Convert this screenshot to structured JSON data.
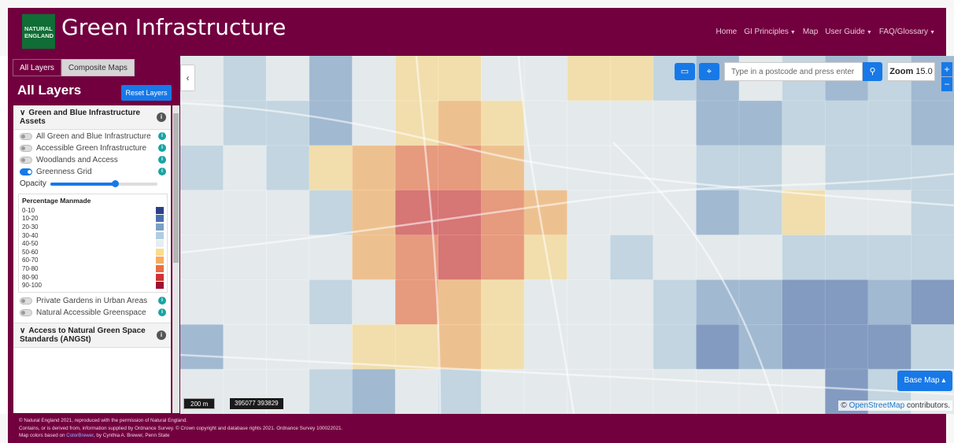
{
  "header": {
    "logo_line1": "NATURAL",
    "logo_line2": "ENGLAND",
    "title": "Green Infrastructure",
    "nav": [
      {
        "label": "Home",
        "dropdown": false
      },
      {
        "label": "GI Principles",
        "dropdown": true
      },
      {
        "label": "Map",
        "dropdown": false
      },
      {
        "label": "User Guide",
        "dropdown": true
      },
      {
        "label": "FAQ/Glossary",
        "dropdown": true
      }
    ]
  },
  "sidebar": {
    "tabs": [
      "All Layers",
      "Composite Maps"
    ],
    "active_tab": "All Layers",
    "panel_title": "All Layers",
    "reset_label": "Reset Layers",
    "section1": {
      "title": "Green and Blue Infrastructure Assets",
      "items": [
        {
          "label": "All Green and Blue Infrastructure",
          "on": false
        },
        {
          "label": "Accessible Green Infrastructure",
          "on": false
        },
        {
          "label": "Woodlands and Access",
          "on": false
        },
        {
          "label": "Greenness Grid",
          "on": true
        }
      ],
      "opacity_label": "Opacity",
      "opacity_value": 0.6,
      "legend_title": "Percentage Manmade",
      "legend": [
        {
          "label": "0-10",
          "color": "#2c3f86"
        },
        {
          "label": "10-20",
          "color": "#4a6fad"
        },
        {
          "label": "20-30",
          "color": "#7aa0c8"
        },
        {
          "label": "30-40",
          "color": "#b0cde0"
        },
        {
          "label": "40-50",
          "color": "#e6eef2"
        },
        {
          "label": "50-60",
          "color": "#fbdc8c"
        },
        {
          "label": "60-70",
          "color": "#f6ad5e"
        },
        {
          "label": "70-80",
          "color": "#ea6d42"
        },
        {
          "label": "80-90",
          "color": "#d03333"
        },
        {
          "label": "90-100",
          "color": "#9e1133"
        }
      ],
      "items_after": [
        {
          "label": "Private Gardens in Urban Areas",
          "on": false
        },
        {
          "label": "Natural Accessible Greenspace",
          "on": false
        }
      ]
    },
    "section2": {
      "title": "Access to Natural Green Space Standards (ANGSt)"
    }
  },
  "map": {
    "search_placeholder": "Type in a postcode and press enter",
    "zoom_label": "Zoom",
    "zoom_value": "15.0",
    "zoom_in": "+",
    "zoom_out": "−",
    "collapse": "‹",
    "basemap_label": "Base Map",
    "scale_label": "200 m",
    "coords": "395077 393829",
    "attribution_link": "OpenStreetMap",
    "attribution_text": " contributors.",
    "attribution_symbol": "©",
    "grid_values": [
      [
        40,
        35,
        40,
        20,
        45,
        55,
        50,
        40,
        45,
        55,
        55,
        35,
        20,
        40,
        30,
        20,
        35,
        25
      ],
      [
        40,
        35,
        30,
        25,
        45,
        55,
        60,
        50,
        40,
        40,
        45,
        40,
        20,
        25,
        30,
        30,
        35,
        20
      ],
      [
        35,
        40,
        30,
        55,
        65,
        75,
        75,
        60,
        45,
        40,
        40,
        45,
        30,
        30,
        40,
        35,
        35,
        30
      ],
      [
        40,
        45,
        40,
        35,
        65,
        80,
        85,
        70,
        60,
        45,
        40,
        40,
        20,
        30,
        55,
        40,
        45,
        30
      ],
      [
        40,
        40,
        40,
        40,
        60,
        75,
        80,
        70,
        55,
        40,
        30,
        40,
        40,
        40,
        35,
        35,
        30,
        30
      ],
      [
        40,
        40,
        40,
        30,
        45,
        70,
        65,
        50,
        40,
        40,
        40,
        35,
        20,
        20,
        10,
        15,
        20,
        15
      ],
      [
        25,
        40,
        40,
        40,
        50,
        55,
        60,
        50,
        45,
        40,
        40,
        30,
        15,
        20,
        15,
        10,
        15,
        30
      ],
      [
        40,
        40,
        40,
        30,
        25,
        40,
        35,
        40,
        45,
        40,
        40,
        40,
        40,
        45,
        40,
        15,
        30,
        40
      ]
    ]
  },
  "footer": {
    "line1": "© Natural England 2021, reproduced with the permission of Natural England.",
    "line2": "Contains, or is derived from, information supplied by Ordnance Survey. © Crown copyright and database rights 2021. Ordnance Survey 100022021.",
    "line3_pre": "Map colors based on ",
    "line3_link": "ColorBrewer",
    "line3_post": ", by Cynthia A. Brewer, Penn State"
  }
}
